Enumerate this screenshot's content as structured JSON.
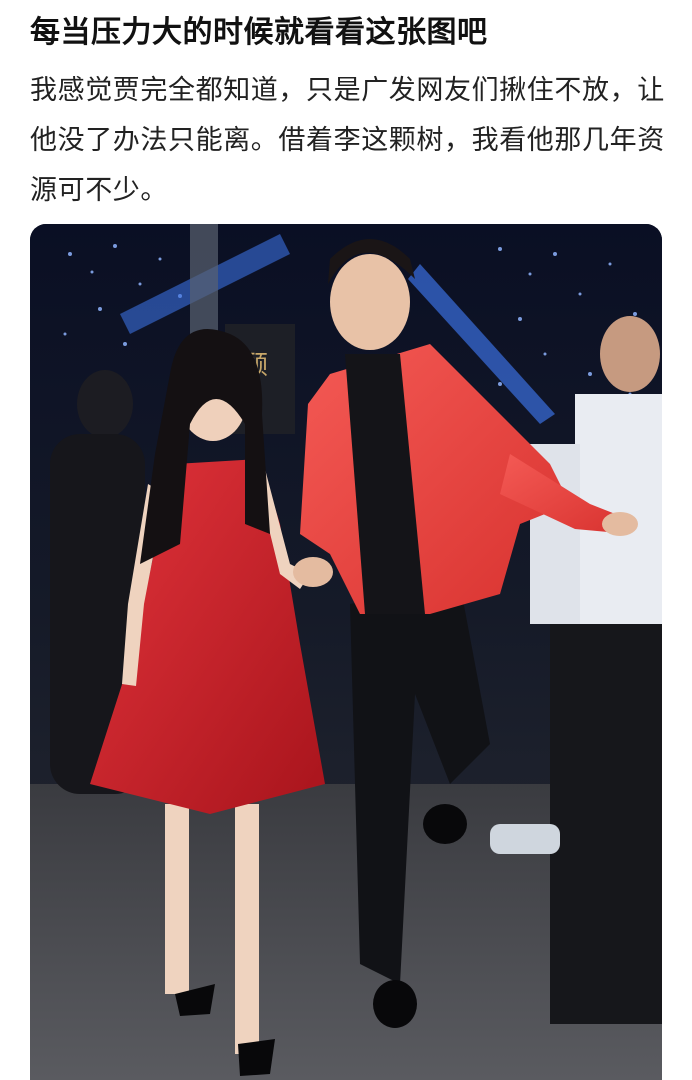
{
  "post": {
    "title": "每当压力大的时候就看看这张图吧",
    "body": "我感觉贾完全都知道，只是广发网友们揪住不放，让他没了办法只能离。借着李这颗树，我看他那几年资源可不少。"
  },
  "photo": {
    "banner_text_fragment": "顾",
    "colors": {
      "background": "#0e1220",
      "dress": "#d4222b",
      "blazer": "#ef4a45",
      "accent_light": "#3b6fe0"
    }
  }
}
